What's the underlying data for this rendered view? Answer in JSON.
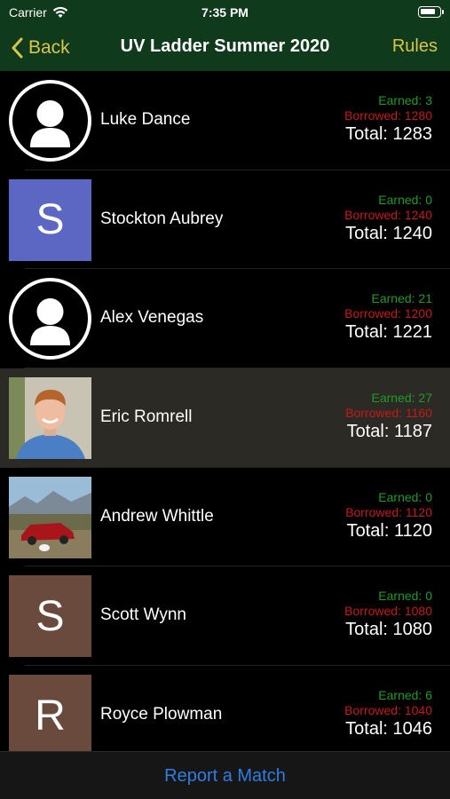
{
  "status_bar": {
    "carrier": "Carrier",
    "time": "7:35 PM",
    "battery_level": 0.8
  },
  "nav": {
    "back_label": "Back",
    "title": "UV Ladder Summer 2020",
    "rules_label": "Rules"
  },
  "colors": {
    "nav_bg": "#0f3a1c",
    "accent": "#d6c64a",
    "earned": "#1f9a2a",
    "borrowed": "#c41a1a",
    "link": "#2f7de1"
  },
  "players": [
    {
      "name": "Luke Dance",
      "avatar_type": "silhouette",
      "earned": "Earned: 3",
      "borrowed": "Borrowed: 1280",
      "total": "Total: 1283"
    },
    {
      "name": "Stockton Aubrey",
      "avatar_type": "letter",
      "avatar_letter": "S",
      "avatar_color": "#5c67c4",
      "earned": "Earned: 0",
      "borrowed": "Borrowed: 1240",
      "total": "Total: 1240"
    },
    {
      "name": "Alex Venegas",
      "avatar_type": "silhouette",
      "earned": "Earned: 21",
      "borrowed": "Borrowed: 1200",
      "total": "Total: 1221"
    },
    {
      "name": "Eric Romrell",
      "avatar_type": "photo-portrait",
      "earned": "Earned: 27",
      "borrowed": "Borrowed: 1160",
      "total": "Total: 1187",
      "selected": true
    },
    {
      "name": "Andrew Whittle",
      "avatar_type": "photo-landscape",
      "earned": "Earned: 0",
      "borrowed": "Borrowed: 1120",
      "total": "Total: 1120"
    },
    {
      "name": "Scott Wynn",
      "avatar_type": "letter",
      "avatar_letter": "S",
      "avatar_color": "#6b4a3e",
      "earned": "Earned: 0",
      "borrowed": "Borrowed: 1080",
      "total": "Total: 1080"
    },
    {
      "name": "Royce Plowman",
      "avatar_type": "letter",
      "avatar_letter": "R",
      "avatar_color": "#6b4a3e",
      "earned": "Earned: 6",
      "borrowed": "Borrowed: 1040",
      "total": "Total: 1046"
    }
  ],
  "footer": {
    "report_label": "Report a Match"
  }
}
